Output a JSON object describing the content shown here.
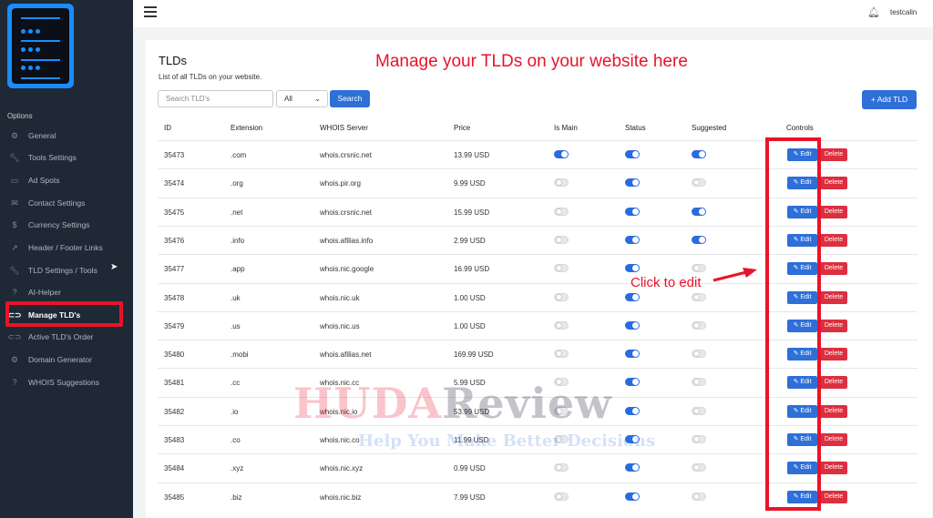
{
  "sidebar": {
    "section_label": "Options",
    "items": [
      {
        "label": "General",
        "icon": "gear-icon"
      },
      {
        "label": "Tools Settings",
        "icon": "wrench-icon"
      },
      {
        "label": "Ad Spots",
        "icon": "monitor-icon"
      },
      {
        "label": "Contact Settings",
        "icon": "envelope-icon"
      },
      {
        "label": "Currency Settings",
        "icon": "dollar-icon"
      },
      {
        "label": "Header / Footer Links",
        "icon": "external-link-icon"
      },
      {
        "label": "TLD Settings / Tools",
        "icon": "wrench-icon"
      },
      {
        "label": "AI-Helper",
        "icon": "help-circle-icon"
      },
      {
        "label": "Manage TLD's",
        "icon": "link-icon"
      },
      {
        "label": "Active TLD's Order",
        "icon": "link-icon"
      },
      {
        "label": "Domain Generator",
        "icon": "gear-icon"
      },
      {
        "label": "WHOIS Suggestions",
        "icon": "help-circle-icon"
      }
    ],
    "active_item": "Manage TLD's"
  },
  "topbar": {
    "username": "testcalin"
  },
  "page": {
    "title": "TLDs",
    "subtitle": "List of all TLDs on your website.",
    "annotation_top": "Manage your TLDs on your website here",
    "annotation_click": "Click to edit"
  },
  "search": {
    "placeholder": "Search TLD's",
    "filter_value": "All",
    "button_label": "Search"
  },
  "add_button_label": "+ Add TLD",
  "table": {
    "columns": [
      "ID",
      "Extension",
      "WHOIS Server",
      "Price",
      "Is Main",
      "Status",
      "Suggested",
      "Controls"
    ],
    "edit_label": "Edit",
    "delete_label": "Delete",
    "rows": [
      {
        "id": "35473",
        "ext": ".com",
        "whois": "whois.crsnic.net",
        "price": "13.99 USD",
        "is_main": true,
        "status": true,
        "suggested": true
      },
      {
        "id": "35474",
        "ext": ".org",
        "whois": "whois.pir.org",
        "price": "9.99 USD",
        "is_main": false,
        "status": true,
        "suggested": false
      },
      {
        "id": "35475",
        "ext": ".net",
        "whois": "whois.crsnic.net",
        "price": "15.99 USD",
        "is_main": false,
        "status": true,
        "suggested": true
      },
      {
        "id": "35476",
        "ext": ".info",
        "whois": "whois.afilias.info",
        "price": "2.99 USD",
        "is_main": false,
        "status": true,
        "suggested": true
      },
      {
        "id": "35477",
        "ext": ".app",
        "whois": "whois.nic.google",
        "price": "16.99 USD",
        "is_main": false,
        "status": true,
        "suggested": false
      },
      {
        "id": "35478",
        "ext": ".uk",
        "whois": "whois.nic.uk",
        "price": "1.00 USD",
        "is_main": false,
        "status": true,
        "suggested": false
      },
      {
        "id": "35479",
        "ext": ".us",
        "whois": "whois.nic.us",
        "price": "1.00 USD",
        "is_main": false,
        "status": true,
        "suggested": false
      },
      {
        "id": "35480",
        "ext": ".mobi",
        "whois": "whois.afilias.net",
        "price": "169.99 USD",
        "is_main": false,
        "status": true,
        "suggested": false
      },
      {
        "id": "35481",
        "ext": ".cc",
        "whois": "whois.nic.cc",
        "price": "5.99 USD",
        "is_main": false,
        "status": true,
        "suggested": false
      },
      {
        "id": "35482",
        "ext": ".io",
        "whois": "whois.nic.io",
        "price": "53.99 USD",
        "is_main": false,
        "status": true,
        "suggested": false
      },
      {
        "id": "35483",
        "ext": ".co",
        "whois": "whois.nic.co",
        "price": "11.99 USD",
        "is_main": false,
        "status": true,
        "suggested": false
      },
      {
        "id": "35484",
        "ext": ".xyz",
        "whois": "whois.nic.xyz",
        "price": "0.99 USD",
        "is_main": false,
        "status": true,
        "suggested": false
      },
      {
        "id": "35485",
        "ext": ".biz",
        "whois": "whois.nic.biz",
        "price": "7.99 USD",
        "is_main": false,
        "status": true,
        "suggested": false
      }
    ]
  },
  "watermark": {
    "line1a": "HUDA",
    "line1b": "Review",
    "line2": "Help You Make Better Decisions"
  },
  "colors": {
    "accent": "#2e6fd8",
    "danger": "#dc2f3f",
    "annotation": "#e8132a",
    "sidebar": "#1f2835"
  }
}
